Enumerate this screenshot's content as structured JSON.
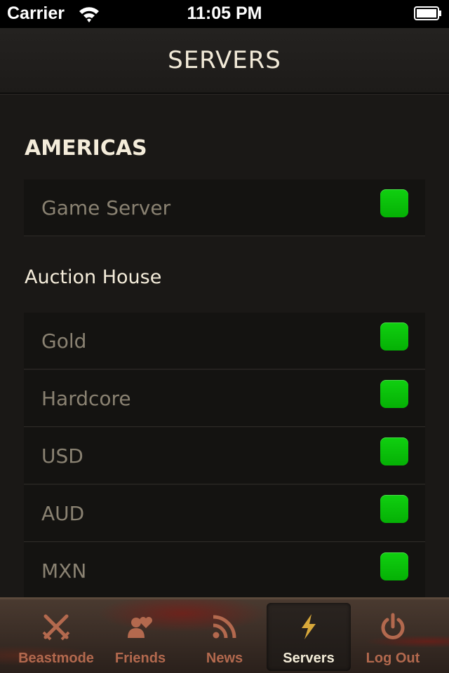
{
  "status_bar": {
    "carrier": "Carrier",
    "time": "11:05 PM",
    "wifi_icon": "wifi-icon",
    "battery_icon": "battery-full-icon"
  },
  "nav": {
    "title": "SERVERS"
  },
  "region": {
    "title": "AMERICAS",
    "game_server": {
      "name": "Game Server",
      "status": "online"
    },
    "auction_house": {
      "title": "Auction House",
      "servers": [
        {
          "name": "Gold",
          "status": "online"
        },
        {
          "name": "Hardcore",
          "status": "online"
        },
        {
          "name": "USD",
          "status": "online"
        },
        {
          "name": "AUD",
          "status": "online"
        },
        {
          "name": "MXN",
          "status": "online"
        }
      ]
    }
  },
  "tabs": [
    {
      "label": "Beastmode",
      "icon": "crossed-swords-icon",
      "active": false
    },
    {
      "label": "Friends",
      "icon": "friends-heart-icon",
      "active": false
    },
    {
      "label": "News",
      "icon": "rss-feed-icon",
      "active": false
    },
    {
      "label": "Servers",
      "icon": "lightning-bolt-icon",
      "active": true
    },
    {
      "label": "Log Out",
      "icon": "power-icon",
      "active": false
    }
  ],
  "colors": {
    "status_online": "#0bbd0b",
    "active_tab_icon": "#d8a83a",
    "inactive_tab": "#b3694e"
  }
}
